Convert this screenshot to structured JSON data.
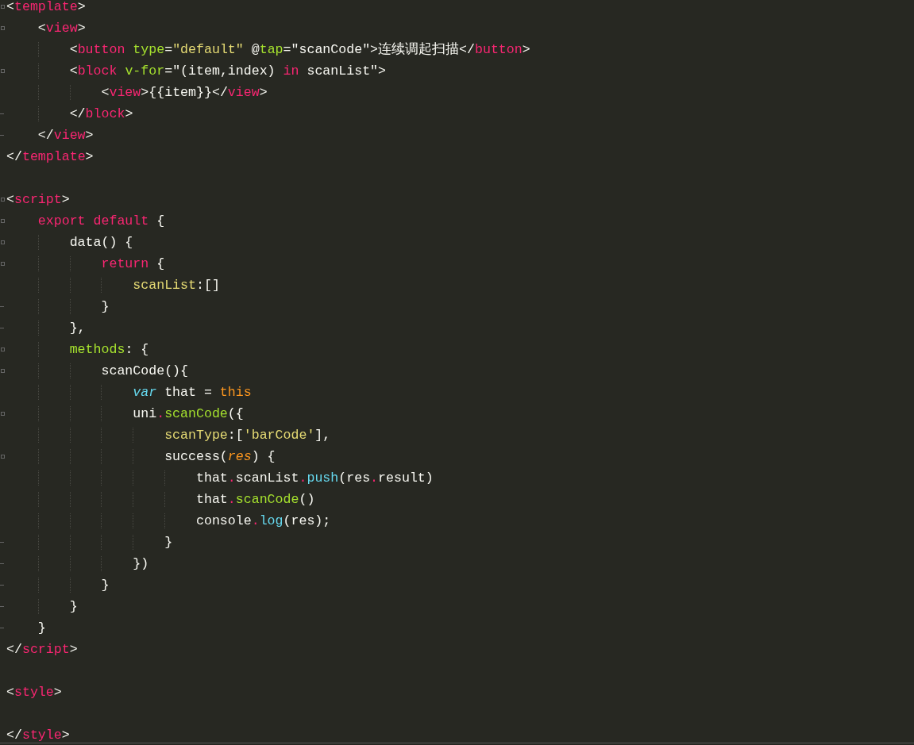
{
  "editor": {
    "lines": [
      {
        "fold_start": true,
        "fold_end": false,
        "tokens": [
          {
            "kind": "punct",
            "text": "<"
          },
          {
            "kind": "tag",
            "text": "template"
          },
          {
            "kind": "punct",
            "text": ">"
          }
        ]
      },
      {
        "fold_start": true,
        "fold_end": false,
        "tokens": [
          {
            "kind": "punct",
            "text": "    <"
          },
          {
            "kind": "tag",
            "text": "view"
          },
          {
            "kind": "punct",
            "text": ">"
          }
        ]
      },
      {
        "fold_start": false,
        "fold_end": false,
        "tokens": [
          {
            "kind": "punct",
            "text": "        <"
          },
          {
            "kind": "tag",
            "text": "button "
          },
          {
            "kind": "attr",
            "text": "type"
          },
          {
            "kind": "punct",
            "text": "="
          },
          {
            "kind": "string",
            "text": "\"default\""
          },
          {
            "kind": "punct",
            "text": " @"
          },
          {
            "kind": "attr",
            "text": "tap"
          },
          {
            "kind": "punct",
            "text": "=\"scanCode\">连续调起扫描</"
          },
          {
            "kind": "tag",
            "text": "button"
          },
          {
            "kind": "punct",
            "text": ">"
          }
        ]
      },
      {
        "fold_start": true,
        "fold_end": false,
        "tokens": [
          {
            "kind": "punct",
            "text": "        <"
          },
          {
            "kind": "tag",
            "text": "block "
          },
          {
            "kind": "attr",
            "text": "v-for"
          },
          {
            "kind": "punct",
            "text": "=\"(item,index) "
          },
          {
            "kind": "keyword",
            "text": "in"
          },
          {
            "kind": "punct",
            "text": " scanList\">"
          }
        ]
      },
      {
        "fold_start": false,
        "fold_end": false,
        "tokens": [
          {
            "kind": "punct",
            "text": "            <"
          },
          {
            "kind": "tag",
            "text": "view"
          },
          {
            "kind": "punct",
            "text": ">{{item}}</"
          },
          {
            "kind": "tag",
            "text": "view"
          },
          {
            "kind": "punct",
            "text": ">"
          }
        ]
      },
      {
        "fold_start": false,
        "fold_end": true,
        "tokens": [
          {
            "kind": "punct",
            "text": "        </"
          },
          {
            "kind": "tag",
            "text": "block"
          },
          {
            "kind": "punct",
            "text": ">"
          }
        ]
      },
      {
        "fold_start": false,
        "fold_end": true,
        "tokens": [
          {
            "kind": "punct",
            "text": "    </"
          },
          {
            "kind": "tag",
            "text": "view"
          },
          {
            "kind": "punct",
            "text": ">"
          }
        ]
      },
      {
        "fold_start": false,
        "fold_end": false,
        "tokens": [
          {
            "kind": "punct",
            "text": "</"
          },
          {
            "kind": "tag",
            "text": "template"
          },
          {
            "kind": "punct",
            "text": ">"
          }
        ]
      },
      {
        "fold_start": false,
        "fold_end": false
      },
      {
        "fold_start": true,
        "fold_end": false,
        "tokens": [
          {
            "kind": "punct",
            "text": "<"
          },
          {
            "kind": "tag",
            "text": "script"
          },
          {
            "kind": "punct",
            "text": ">"
          }
        ]
      },
      {
        "fold_start": true,
        "fold_end": false,
        "tokens": [
          {
            "kind": "keyword",
            "text": "    export default"
          },
          {
            "kind": "punct",
            "text": " {"
          }
        ]
      },
      {
        "fold_start": true,
        "fold_end": false,
        "tokens": [
          {
            "kind": "punct",
            "text": "        data() {"
          }
        ]
      },
      {
        "fold_start": true,
        "fold_end": false,
        "tokens": [
          {
            "kind": "keyword",
            "text": "            return"
          },
          {
            "kind": "punct",
            "text": " {"
          }
        ]
      },
      {
        "fold_start": false,
        "fold_end": false,
        "tokens": [
          {
            "kind": "prop",
            "text": "                scanList"
          },
          {
            "kind": "punct",
            "text": ":[]"
          }
        ]
      },
      {
        "fold_start": false,
        "fold_end": true,
        "tokens": [
          {
            "kind": "punct",
            "text": "            }"
          }
        ]
      },
      {
        "fold_start": false,
        "fold_end": true,
        "tokens": [
          {
            "kind": "punct",
            "text": "        },"
          }
        ]
      },
      {
        "fold_start": true,
        "fold_end": false,
        "tokens": [
          {
            "kind": "func",
            "text": "        methods"
          },
          {
            "kind": "punct",
            "text": ": {"
          }
        ]
      },
      {
        "fold_start": true,
        "fold_end": false,
        "tokens": [
          {
            "kind": "punct",
            "text": "            scanCode(){"
          }
        ]
      },
      {
        "fold_start": false,
        "fold_end": false,
        "tokens": [
          {
            "kind": "storage",
            "text": "                var"
          },
          {
            "kind": "punct",
            "text": " that = "
          },
          {
            "kind": "this",
            "text": "this"
          }
        ]
      },
      {
        "fold_start": true,
        "fold_end": false,
        "tokens": [
          {
            "kind": "punct",
            "text": "                uni"
          },
          {
            "kind": "op",
            "text": "."
          },
          {
            "kind": "func",
            "text": "scanCode"
          },
          {
            "kind": "punct",
            "text": "({"
          }
        ]
      },
      {
        "fold_start": false,
        "fold_end": false,
        "tokens": [
          {
            "kind": "prop",
            "text": "                    scanType"
          },
          {
            "kind": "punct",
            "text": ":["
          },
          {
            "kind": "string",
            "text": "'barCode'"
          },
          {
            "kind": "punct",
            "text": "],"
          }
        ]
      },
      {
        "fold_start": true,
        "fold_end": false,
        "tokens": [
          {
            "kind": "punct",
            "text": "                    success("
          },
          {
            "kind": "param",
            "text": "res"
          },
          {
            "kind": "punct",
            "text": ") {"
          }
        ]
      },
      {
        "fold_start": false,
        "fold_end": false,
        "tokens": [
          {
            "kind": "punct",
            "text": "                        that"
          },
          {
            "kind": "op",
            "text": "."
          },
          {
            "kind": "punct",
            "text": "scanList"
          },
          {
            "kind": "op",
            "text": "."
          },
          {
            "kind": "support",
            "text": "push"
          },
          {
            "kind": "punct",
            "text": "(res"
          },
          {
            "kind": "op",
            "text": "."
          },
          {
            "kind": "punct",
            "text": "result)"
          }
        ]
      },
      {
        "fold_start": false,
        "fold_end": false,
        "tokens": [
          {
            "kind": "punct",
            "text": "                        that"
          },
          {
            "kind": "op",
            "text": "."
          },
          {
            "kind": "func",
            "text": "scanCode"
          },
          {
            "kind": "punct",
            "text": "()"
          }
        ]
      },
      {
        "fold_start": false,
        "fold_end": false,
        "tokens": [
          {
            "kind": "punct",
            "text": "                        console"
          },
          {
            "kind": "op",
            "text": "."
          },
          {
            "kind": "support",
            "text": "log"
          },
          {
            "kind": "punct",
            "text": "(res);"
          }
        ]
      },
      {
        "fold_start": false,
        "fold_end": true,
        "tokens": [
          {
            "kind": "punct",
            "text": "                    }"
          }
        ]
      },
      {
        "fold_start": false,
        "fold_end": true,
        "tokens": [
          {
            "kind": "punct",
            "text": "                })"
          }
        ]
      },
      {
        "fold_start": false,
        "fold_end": true,
        "tokens": [
          {
            "kind": "punct",
            "text": "            }"
          }
        ]
      },
      {
        "fold_start": false,
        "fold_end": true,
        "tokens": [
          {
            "kind": "punct",
            "text": "        }"
          }
        ]
      },
      {
        "fold_start": false,
        "fold_end": true,
        "tokens": [
          {
            "kind": "punct",
            "text": "    }"
          }
        ]
      },
      {
        "fold_start": false,
        "fold_end": false,
        "tokens": [
          {
            "kind": "punct",
            "text": "</"
          },
          {
            "kind": "tag",
            "text": "script"
          },
          {
            "kind": "punct",
            "text": ">"
          }
        ]
      },
      {
        "fold_start": false,
        "fold_end": false
      },
      {
        "fold_start": false,
        "fold_end": false,
        "tokens": [
          {
            "kind": "punct",
            "text": "<"
          },
          {
            "kind": "tag",
            "text": "style"
          },
          {
            "kind": "punct",
            "text": ">"
          }
        ]
      },
      {
        "fold_start": false,
        "fold_end": false
      },
      {
        "fold_start": false,
        "fold_end": false,
        "tokens": [
          {
            "kind": "punct",
            "text": "</"
          },
          {
            "kind": "tag",
            "text": "style"
          },
          {
            "kind": "punct",
            "text": ">"
          }
        ]
      }
    ]
  }
}
